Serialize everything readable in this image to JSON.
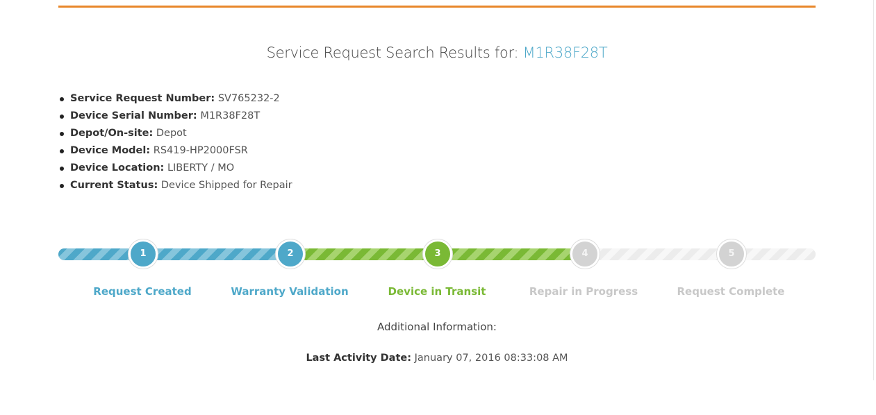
{
  "header": {
    "title_prefix": "Service Request Search Results for:",
    "serial": "M1R38F28T"
  },
  "details": [
    {
      "label": "Service Request Number:",
      "value": "SV765232-2"
    },
    {
      "label": "Device Serial Number:",
      "value": "M1R38F28T"
    },
    {
      "label": "Depot/On-site:",
      "value": "Depot"
    },
    {
      "label": "Device Model:",
      "value": "RS419-HP2000FSR"
    },
    {
      "label": "Device Location:",
      "value": "LIBERTY / MO"
    },
    {
      "label": "Current Status:",
      "value": "Device Shipped for Repair"
    }
  ],
  "progress": {
    "current_step": 3,
    "total_steps": 5,
    "steps": [
      {
        "number": "1",
        "label": "Request Created",
        "state": "done"
      },
      {
        "number": "2",
        "label": "Warranty Validation",
        "state": "done"
      },
      {
        "number": "3",
        "label": "Device in Transit",
        "state": "current"
      },
      {
        "number": "4",
        "label": "Repair in Progress",
        "state": "todo"
      },
      {
        "number": "5",
        "label": "Request Complete",
        "state": "todo"
      }
    ]
  },
  "colors": {
    "accent_orange": "#e8872a",
    "done_blue": "#4ea8c9",
    "current_green": "#7ab935",
    "todo_grey": "#d3d3d3"
  },
  "additional": {
    "heading": "Additional Information:",
    "last_activity_label": "Last Activity Date:",
    "last_activity_value": "January 07, 2016 08:33:08 AM"
  }
}
